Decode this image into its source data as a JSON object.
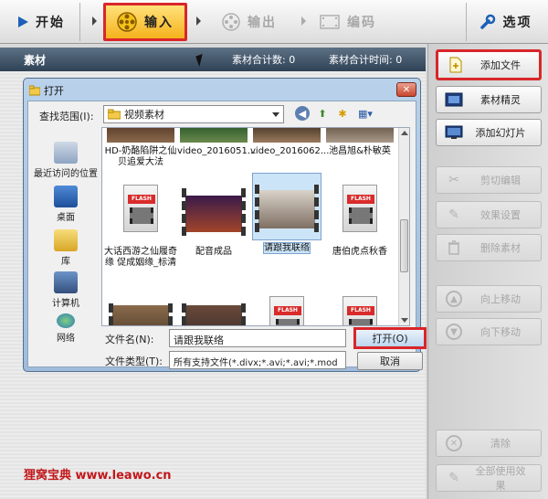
{
  "toolbar": {
    "start": "开始",
    "input": "输入",
    "output": "输出",
    "encode": "编码",
    "options": "选项"
  },
  "panel": {
    "title": "素材",
    "count_label": "素材合计数: 0",
    "time_label": "素材合计时间: 0"
  },
  "sidebar": {
    "add_file": "添加文件",
    "material_wizard": "素材精灵",
    "add_slideshow": "添加幻灯片",
    "cut_edit": "剪切编辑",
    "effect_settings": "效果设置",
    "delete_material": "删除素材",
    "move_up": "向上移动",
    "move_down": "向下移动",
    "clear": "清除",
    "apply_all_effects": "全部使用效果"
  },
  "brand": "狸窝宝典 www.leawo.cn",
  "dialog": {
    "title": "打开",
    "look_in_label": "查找范围(I):",
    "look_in_value": "视频素材",
    "places": [
      "最近访问的位置",
      "桌面",
      "库",
      "计算机",
      "网络"
    ],
    "file_name_label": "文件名(N):",
    "file_name_value": "请跟我联络",
    "file_type_label": "文件类型(T):",
    "file_type_value": "所有支持文件(*.divx;*.avi;*.avi;*.mod",
    "open_button": "打开(O)",
    "cancel_button": "取消",
    "files_row1": [
      "HD-奶酪陷阱之仙贝追爱大法",
      "video_2016051...",
      "video_2016062...",
      "池昌旭&朴敏英"
    ],
    "files_row2": [
      "大话西游之仙履奇缘 促成姻缘_标清",
      "配音成品",
      "请跟我联络",
      "唐伯虎点秋香"
    ]
  },
  "colors": {
    "highlight_red": "#d9262a",
    "header_blue": "#3a4e63",
    "brand_red": "#c2181b"
  }
}
